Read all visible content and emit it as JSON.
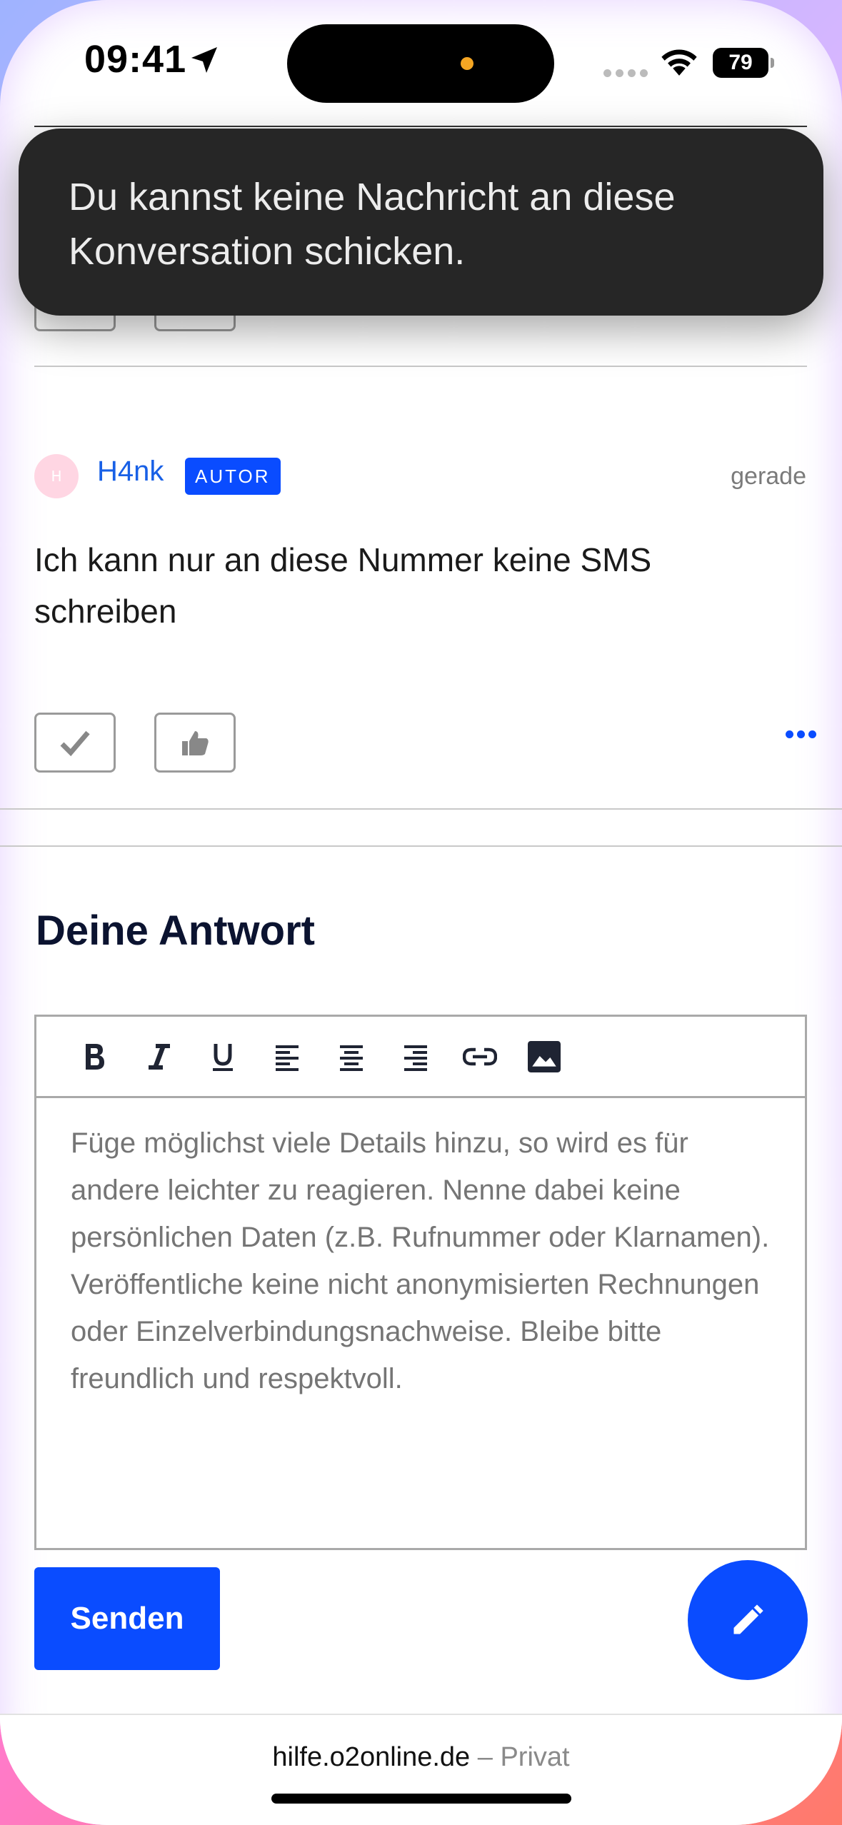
{
  "status_bar": {
    "time": "09:41",
    "battery": "79"
  },
  "toast": {
    "message": "Du kannst keine Nachricht an diese Konversation schicken."
  },
  "post": {
    "avatar_initial": "H",
    "author": "H4nk",
    "badge": "AUTOR",
    "timestamp": "gerade",
    "body": "Ich kann nur an diese Nummer keine SMS schreiben"
  },
  "reply": {
    "title": "Deine Antwort",
    "placeholder": "Füge möglichst viele Details hinzu, so wird es für andere leichter zu reagieren. Nenne dabei keine persönlichen Daten (z.B. Rufnummer oder Klarnamen). Veröffentliche keine nicht anonymisierten Rechnungen oder Einzelverbindungsnachweise. Bleibe bitte freundlich und respektvoll.",
    "toolbar": [
      "bold-icon",
      "italic-icon",
      "underline-icon",
      "align-left-icon",
      "align-center-icon",
      "align-right-icon",
      "link-icon",
      "image-icon"
    ],
    "send_label": "Senden"
  },
  "browser": {
    "domain": "hilfe.o2online.de",
    "separator": "–",
    "mode": "Privat"
  },
  "colors": {
    "accent": "#0a4cff",
    "toast_bg": "#262626",
    "author_link": "#1860e6"
  }
}
